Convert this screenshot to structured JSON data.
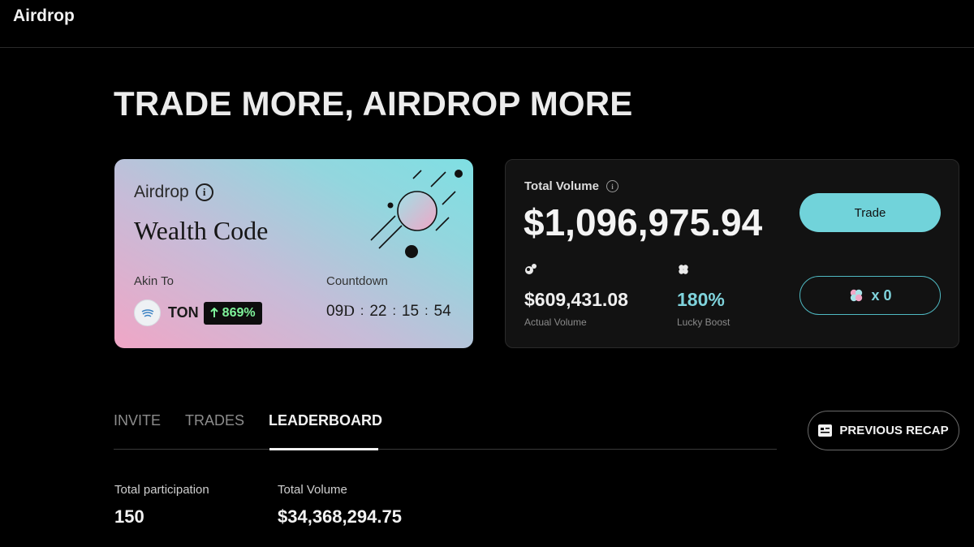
{
  "app": {
    "title": "Airdrop"
  },
  "hero": {
    "headline": "TRADE MORE, AIRDROP MORE"
  },
  "airdrop_card": {
    "label": "Airdrop",
    "name": "Wealth Code",
    "akin_label": "Akin To",
    "token": "TON",
    "change": "869%",
    "countdown_label": "Countdown",
    "countdown": {
      "days": "09",
      "days_unit": "D",
      "hours": "22",
      "minutes": "15",
      "seconds": "54"
    },
    "gradient_colors": [
      "#f0a6c6",
      "#c6bcd8",
      "#7fdfe3"
    ]
  },
  "volume_panel": {
    "label": "Total Volume",
    "value": "$1,096,975.94",
    "actual_value": "$609,431.08",
    "actual_label": "Actual Volume",
    "boost_value": "180%",
    "boost_label": "Lucky Boost",
    "trade_label": "Trade",
    "clover_count": "x 0",
    "accent_color": "#71d3da"
  },
  "tabs": [
    {
      "label": "INVITE",
      "active": false
    },
    {
      "label": "TRADES",
      "active": false
    },
    {
      "label": "LEADERBOARD",
      "active": true
    }
  ],
  "recap_button": {
    "label": "PREVIOUS RECAP"
  },
  "stats": {
    "participation_label": "Total participation",
    "participation_value": "150",
    "volume_label": "Total Volume",
    "volume_value": "$34,368,294.75"
  },
  "icons": [
    "info-icon",
    "ton-logo-icon",
    "arrow-up-icon",
    "planet-decoration-icon",
    "bubbles-icon",
    "clover-icon",
    "recap-icon"
  ]
}
